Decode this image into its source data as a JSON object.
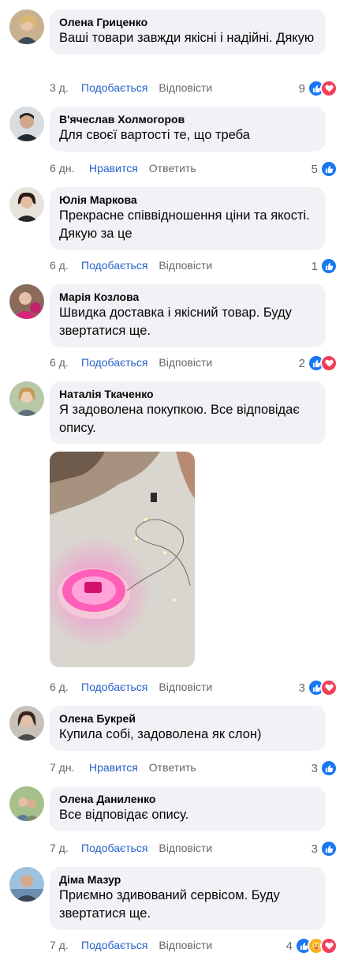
{
  "comments": [
    {
      "author": "Олена Гриценко",
      "text": "Ваші товари завжди якісні і надійні. Дякую",
      "time": "3 д.",
      "like": "Подобається",
      "reply": "Відповісти",
      "count": "9",
      "reactions": [
        "like",
        "love"
      ]
    },
    {
      "author": "В'ячеслав Холмогоров",
      "text": "Для своєї вартості те, що треба",
      "time": "6 дн.",
      "like": "Нравится",
      "reply": "Ответить",
      "count": "5",
      "reactions": [
        "like"
      ]
    },
    {
      "author": "Юлія Маркова",
      "text": "Прекрасне співвідношення ціни та якості. Дякую за це",
      "time": "6 д.",
      "like": "Подобається",
      "reply": "Відповісти",
      "count": "1",
      "reactions": [
        "like"
      ]
    },
    {
      "author": "Марія Козлова",
      "text": "Швидка доставка і якісний товар. Буду звертатися ще.",
      "time": "6 д.",
      "like": "Подобається",
      "reply": "Відповісти",
      "count": "2",
      "reactions": [
        "like",
        "love"
      ]
    },
    {
      "author": "Наталія Ткаченко",
      "text": "Я задоволена покупкою. Все відповідає опису.",
      "time": "6 д.",
      "like": "Подобається",
      "reply": "Відповісти",
      "count": "3",
      "reactions": [
        "like",
        "love"
      ]
    },
    {
      "author": "Олена Букрей",
      "text": "Купила собі, задоволена як слон)",
      "time": "7 дн.",
      "like": "Нравится",
      "reply": "Ответить",
      "count": "3",
      "reactions": [
        "like"
      ]
    },
    {
      "author": "Олена Даниленко",
      "text": "Все відповідає опису.",
      "time": "7 д.",
      "like": "Подобається",
      "reply": "Відповісти",
      "count": "3",
      "reactions": [
        "like"
      ]
    },
    {
      "author": "Діма Мазур",
      "text": "Приємно здивований сервісом. Буду звертатися ще.",
      "time": "7 д.",
      "like": "Подобається",
      "reply": "Відповісти",
      "count": "4",
      "reactions": [
        "like",
        "care",
        "love"
      ]
    }
  ],
  "colors": {
    "accent": "#2562c9",
    "meta": "#65676b",
    "bubble": "#f0f2f5",
    "like": "#1877f2",
    "love": "#f33e58",
    "care": "#f7b125"
  },
  "icons": {
    "like": "thumbs-up-icon",
    "love": "heart-icon",
    "care": "care-icon"
  }
}
